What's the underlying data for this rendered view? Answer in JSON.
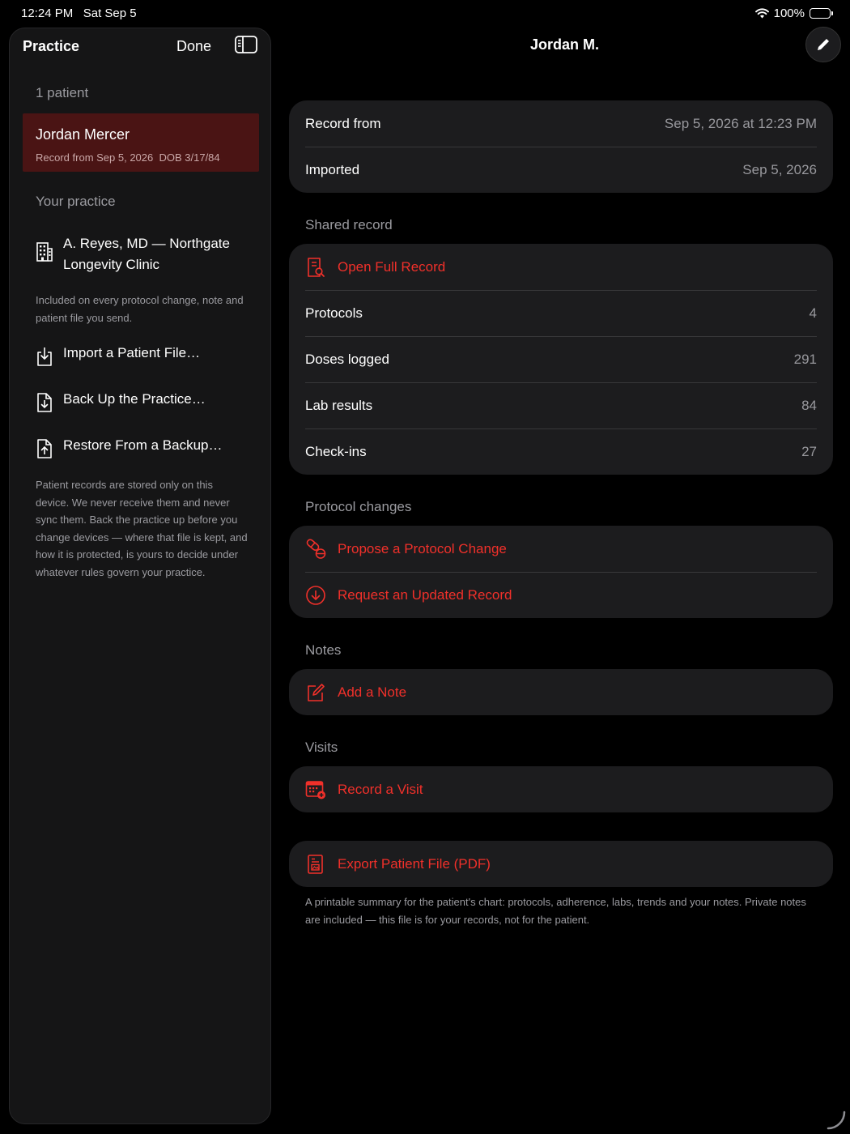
{
  "status": {
    "time": "12:24 PM",
    "date": "Sat Sep 5",
    "battery": "100%"
  },
  "sidebar": {
    "title": "Practice",
    "done_label": "Done",
    "patient_count": "1 patient",
    "patient": {
      "name": "Jordan Mercer",
      "record": "Record from Sep 5, 2026",
      "dob": "DOB 3/17/84"
    },
    "your_practice": "Your practice",
    "practice_name": "A. Reyes, MD — Northgate Longevity Clinic",
    "practice_note": "Included on every protocol change, note and patient file you send.",
    "actions": {
      "import": "Import a Patient File…",
      "backup": "Back Up the Practice…",
      "restore": "Restore From a Backup…"
    },
    "storage_note": "Patient records are stored only on this device. We never receive them and never sync them. Back the practice up before you change devices — where that file is kept, and how it is protected, is yours to decide under whatever rules govern your practice."
  },
  "main": {
    "title": "Jordan M.",
    "summary": {
      "record_from_label": "Record from",
      "record_from_value": "Sep 5, 2026 at 12:23 PM",
      "imported_label": "Imported",
      "imported_value": "Sep 5, 2026"
    },
    "shared": {
      "header": "Shared record",
      "open_full": "Open Full Record",
      "rows": [
        {
          "label": "Protocols",
          "value": "4"
        },
        {
          "label": "Doses logged",
          "value": "291"
        },
        {
          "label": "Lab results",
          "value": "84"
        },
        {
          "label": "Check-ins",
          "value": "27"
        }
      ]
    },
    "protocol": {
      "header": "Protocol changes",
      "propose": "Propose a Protocol Change",
      "request": "Request an Updated Record"
    },
    "notes": {
      "header": "Notes",
      "add": "Add a Note"
    },
    "visits": {
      "header": "Visits",
      "record": "Record a Visit"
    },
    "export": {
      "label": "Export Patient File (PDF)",
      "note": "A printable summary for the patient's chart: protocols, adherence, labs, trends and your notes. Private notes are included — this file is for your records, not for the patient."
    }
  },
  "colors": {
    "accent": "#f0302a",
    "selected_row": "#4a1414",
    "card": "#1c1c1e"
  }
}
